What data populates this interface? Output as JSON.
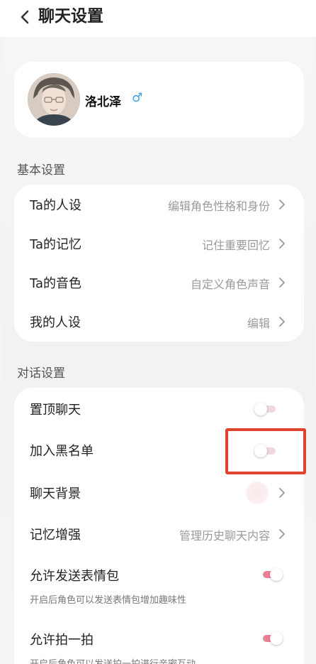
{
  "header": {
    "title": "聊天设置"
  },
  "profile": {
    "name": "洛北泽",
    "gender_symbol": "♂",
    "gender_color": "#3aa0e8"
  },
  "basic": {
    "title": "基本设置",
    "items": [
      {
        "label": "Ta的人设",
        "value": "编辑角色性格和身份"
      },
      {
        "label": "Ta的记忆",
        "value": "记住重要回忆"
      },
      {
        "label": "Ta的音色",
        "value": "自定义角色声音"
      },
      {
        "label": "我的人设",
        "value": "编辑"
      }
    ]
  },
  "chat": {
    "title": "对话设置",
    "pin": {
      "label": "置顶聊天",
      "enabled": false
    },
    "blacklist": {
      "label": "加入黑名单",
      "enabled": false
    },
    "background": {
      "label": "聊天背景"
    },
    "memory": {
      "label": "记忆增强",
      "value": "管理历史聊天内容"
    },
    "stickers": {
      "label": "允许发送表情包",
      "enabled": true,
      "desc": "开启后角色可以发送表情包增加趣味性"
    },
    "pat": {
      "label": "允许拍一拍",
      "enabled": true,
      "desc": "开启后角色可以发送拍一拍进行亲密互动"
    }
  },
  "colors": {
    "accent": "#ec7f95",
    "highlight_border": "#e0442c"
  }
}
